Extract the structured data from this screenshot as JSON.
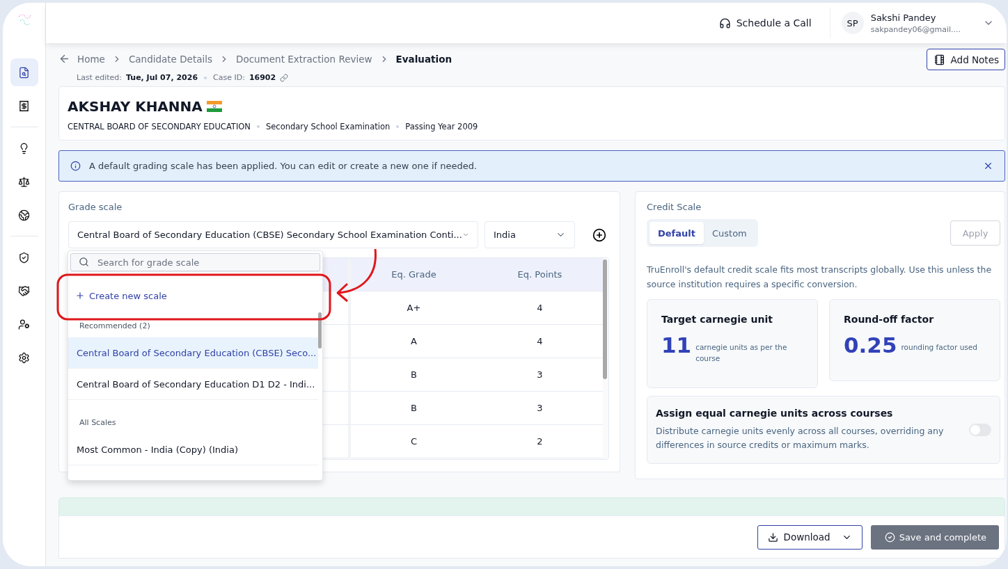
{
  "sidebar": {
    "groups": [
      {
        "items": [
          {
            "selected": true
          },
          {
            "selected": false
          }
        ]
      },
      {
        "items": [
          {
            "selected": false
          },
          {
            "selected": false
          },
          {
            "selected": false
          }
        ]
      },
      {
        "items": [
          {
            "selected": false
          },
          {
            "selected": false
          },
          {
            "selected": false
          },
          {
            "selected": false
          }
        ]
      }
    ]
  },
  "topbar": {
    "schedule_call": "Schedule a Call",
    "user": {
      "initials": "SP",
      "name": "Sakshi Pandey",
      "email": "sakpandey06@gmail...."
    }
  },
  "breadcrumb": [
    {
      "label": "Home",
      "current": false
    },
    {
      "label": "Candidate Details",
      "current": false
    },
    {
      "label": "Document Extraction Review",
      "current": false
    },
    {
      "label": "Evaluation",
      "current": true
    }
  ],
  "meta": {
    "last_edited_label": "Last edited:",
    "last_edited": "Tue, Jul 07, 2026",
    "case_id_label": "Case ID:",
    "case_id": "16902"
  },
  "add_notes": "Add Notes",
  "candidate": {
    "name": "AKSHAY KHANNA",
    "details": [
      "CENTRAL BOARD OF SECONDARY EDUCATION",
      "Secondary School Examination",
      "Passing Year 2009"
    ]
  },
  "alert": {
    "text": "A default grading scale has been applied. You can edit or create a new one if needed."
  },
  "grade_scale": {
    "title": "Grade scale",
    "scale_select": "Central Board of Secondary Education (CBSE) Secondary School Examination Conti...",
    "country_select": "India",
    "table": {
      "columns": [
        {
          "label": "Eq. Grade"
        },
        {
          "label": "Eq. Points"
        }
      ],
      "rows": [
        {
          "grade": "A+",
          "points": "4"
        },
        {
          "grade": "A",
          "points": "4"
        },
        {
          "grade": "B",
          "points": "3"
        },
        {
          "grade": "B",
          "points": "3"
        },
        {
          "grade": "C",
          "points": "2"
        }
      ]
    },
    "dropdown": {
      "search_placeholder": "Search for grade scale",
      "create": "Create new scale",
      "groups": [
        {
          "heading": "Recommended (2)",
          "options": [
            {
              "label": "Central Board of Secondary Education (CBSE) Seco...",
              "selected": true
            },
            {
              "label": "Central Board of Secondary Education D1 D2 - Indi...",
              "selected": false
            }
          ]
        },
        {
          "heading": "All Scales",
          "options": [
            {
              "label": "Most Common - India (Copy) (India)",
              "selected": false
            }
          ]
        }
      ]
    }
  },
  "credit_scale": {
    "title": "Credit Scale",
    "tabs": [
      {
        "label": "Default",
        "selected": true
      },
      {
        "label": "Custom",
        "selected": false
      }
    ],
    "apply": {
      "label": "Apply",
      "disabled": true
    },
    "description": "TruEnroll's default credit scale fits most transcripts globally. Use this unless the source institution requires a specific conversion.",
    "cards": [
      {
        "title": "Target carnegie unit",
        "value": "11",
        "caption": "carnegie units as per the course"
      },
      {
        "title": "Round-off factor",
        "value": "0.25",
        "caption": "rounding factor used"
      }
    ],
    "equal_units": {
      "title": "Assign equal carnegie units across courses",
      "description": "Distribute carnegie units evenly across all courses, overriding any differences in source credits or maximum marks.",
      "on": false
    }
  },
  "footer": {
    "download": "Download",
    "save": {
      "label": "Save and complete",
      "disabled": true
    }
  }
}
